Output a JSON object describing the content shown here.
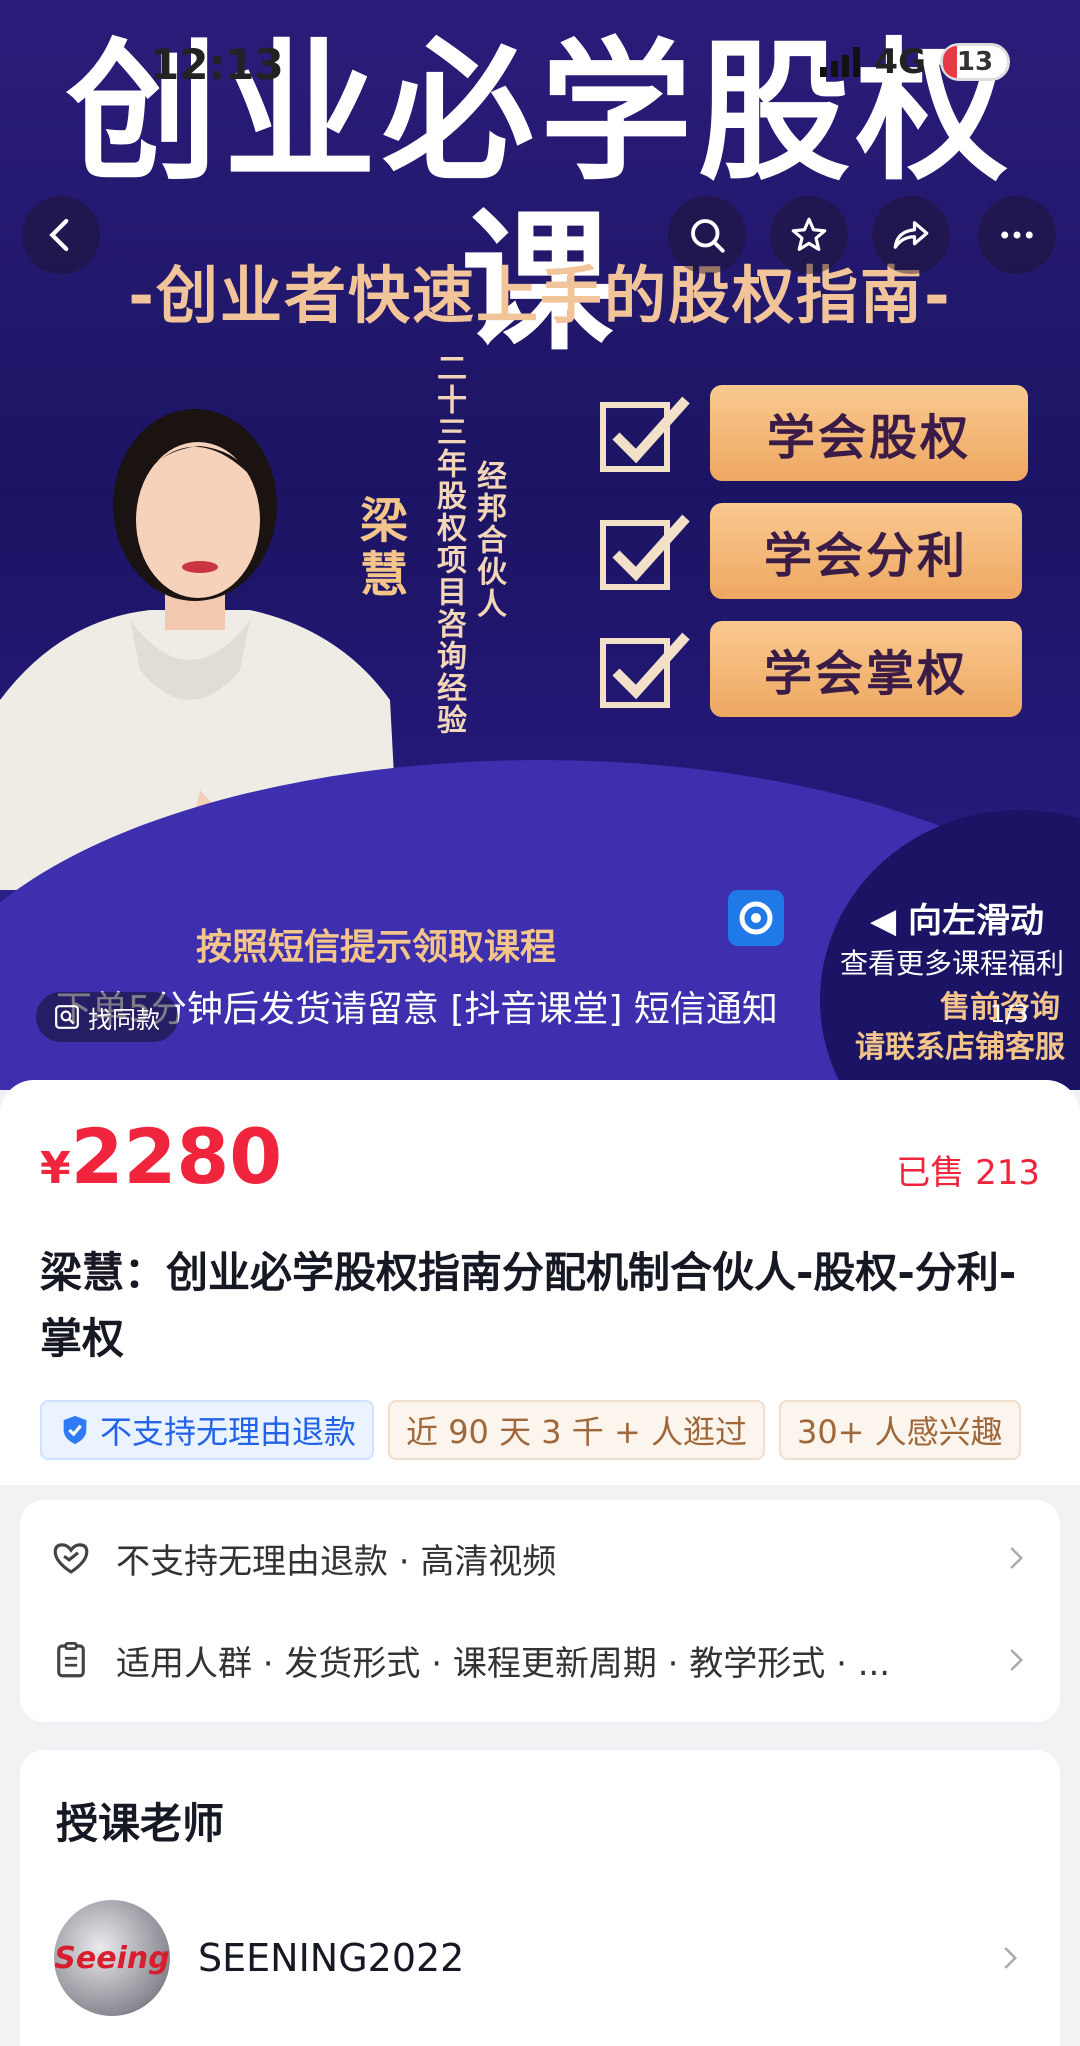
{
  "status_bar": {
    "time": "12:13",
    "network": "4G",
    "battery": "13"
  },
  "banner": {
    "title": "创业必学股权课",
    "subtitle": "-创业者快速上手的股权指南-",
    "teacher_name": "梁慧",
    "experience": "二十三年股权项目咨询经验",
    "role": "经邦合伙人",
    "features": [
      "学会股权",
      "学会分利",
      "学会掌权"
    ],
    "notice_1": "按照短信提示领取课程",
    "notice_2": "下单5分钟后发货请留意 [抖音课堂] 短信通知",
    "swipe_hint": "◀ 向左滑动",
    "side_1": "查看更多课程福利",
    "side_2": "售前咨询",
    "side_3": "请联系店铺客服",
    "find_same": "找同款",
    "pager": "1/3"
  },
  "product": {
    "currency": "¥",
    "price": "2280",
    "sold": "已售 213",
    "title": "梁慧：创业必学股权指南分配机制合伙人-股权-分利-掌权",
    "tags": [
      "不支持无理由退款",
      "近 90 天 3 千 + 人逛过",
      "30+ 人感兴趣"
    ]
  },
  "services": {
    "row1": "不支持无理由退款 · 高清视频",
    "row2": "适用人群 · 发货形式 · 课程更新周期 · 教学形式 · ..."
  },
  "teacher": {
    "heading": "授课老师",
    "name": "SEENING2022",
    "avatar_text": "Seeing"
  },
  "colors": {
    "price_red": "#f0243c",
    "banner_navy": "#1c1463",
    "feature_orange": "#eea862"
  }
}
